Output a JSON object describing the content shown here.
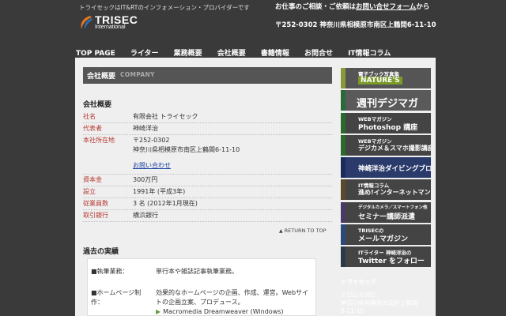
{
  "header": {
    "tagline": "トライセックはIT&RTのインフォメーション・プロバイダーです",
    "logo_name": "TRISEC",
    "logo_sub": "International",
    "contact_prefix": "お仕事のご相談・ご依頼は",
    "contact_link": "お問い合せフォーム",
    "contact_suffix": "から",
    "address": "〒252-0302 神奈川県相模原市南区上鶴間6-11-10"
  },
  "nav": [
    "TOP PAGE",
    "ライター",
    "業務概要",
    "会社概要",
    "書籍情報",
    "お問合せ",
    "IT情報コラム"
  ],
  "page": {
    "heading": "会社概要",
    "heading_sub": "COMPANY",
    "section_title": "会社概要",
    "rows": [
      {
        "label": "社名",
        "value": "有限会社 トライセック"
      },
      {
        "label": "代表者",
        "value": "神崎洋治"
      },
      {
        "label": "本社所在地",
        "value": "〒252-0302",
        "value2": "神奈川県相模原市南区上鶴間6-11-10",
        "link": "お問い合わせ"
      },
      {
        "label": "資本金",
        "value": "300万円"
      },
      {
        "label": "設立",
        "value": "1991年 (平成3年)"
      },
      {
        "label": "従業員数",
        "value": "3 名 (2012年1月現在)"
      },
      {
        "label": "取引銀行",
        "value": "横浜銀行"
      }
    ],
    "back_to_top": "RETURN TO TOP",
    "section2_title": "過去の実績",
    "works": [
      {
        "label": "■執筆業務：",
        "value": "単行本や雑誌記事執筆業務。"
      },
      {
        "label": "■ホームページ制作：",
        "value": "効果的なホームページの企画、作成、運営。Webサイトの企画立案、プロデュース。",
        "bullet": "Macromedia Dreamweaver (Windows)"
      }
    ]
  },
  "sidebar": {
    "banners": [
      {
        "small": "電子ブック写真集",
        "big": "NATURE'S",
        "color": "#555555",
        "accent": "#8a9a3a"
      },
      {
        "big_only": "週刊デジマガ",
        "color": "#5a5a5a",
        "accent": "#2a6a3a"
      },
      {
        "small": "WEBマガジン",
        "big": "Photoshop 講座",
        "color": "#444444",
        "accent": "#2a6a2a"
      },
      {
        "small": "WEBマガジン",
        "big": "デジカメ＆スマホ撮影講座",
        "color": "#444444",
        "accent": "#2a6a2a"
      },
      {
        "big": "神崎洋治ダイビングブログ",
        "color": "#2a3a6a",
        "accent": "#2a3a6a"
      },
      {
        "small": "IT情報コラム",
        "big": "進め!インターネットマン",
        "color": "#444444",
        "accent": "#5a4a2a"
      },
      {
        "small": "デジタルカメラ／スマートフォン他",
        "big": "セミナー講師派遣",
        "color": "#444444",
        "accent": "#4a3a6a"
      },
      {
        "small": "TRISECの",
        "big": "メールマガジン",
        "color": "#444444",
        "accent": "#2a4a7a"
      },
      {
        "small": "ITライター 神崎洋治の",
        "big": "Twitter をフォロー",
        "color": "#444444",
        "accent": "#2a3a4a"
      }
    ],
    "address_title": "トライセック",
    "address_lines": [
      "〒252-0302",
      "神奈川県相模原市南区上鶴間",
      "6-11-10"
    ]
  }
}
